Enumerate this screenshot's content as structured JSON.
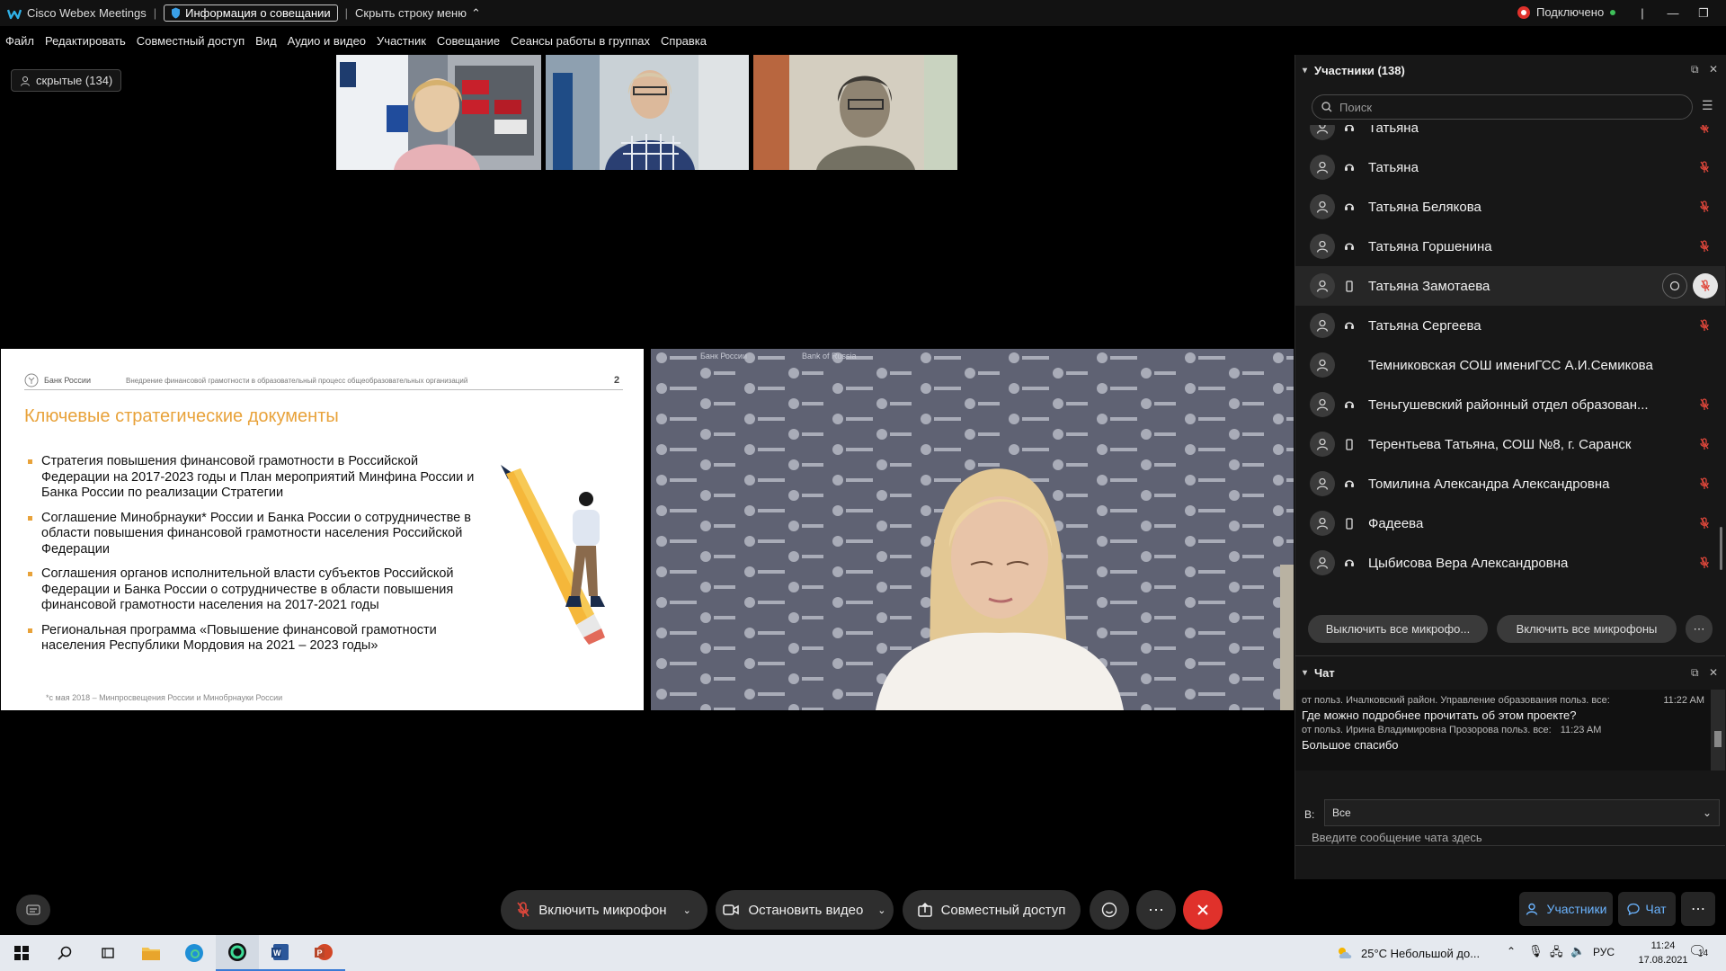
{
  "titlebar": {
    "app": "Cisco Webex Meetings",
    "meeting_info": "Информация о совещании",
    "hide_menu": "Скрыть строку меню",
    "connection": "Подключено"
  },
  "menu": [
    "Файл",
    "Редактировать",
    "Совместный доступ",
    "Вид",
    "Аудио и видео",
    "Участник",
    "Совещание",
    "Сеансы работы в группах",
    "Справка"
  ],
  "hidden_participants": "скрытые (134)",
  "slide": {
    "org": "Банк России",
    "header": "Внедрение финансовой грамотности в образовательный процесс общеобразовательных организаций",
    "page": "2",
    "title": "Ключевые стратегические документы",
    "bullets": [
      "Стратегия повышения финансовой грамотности в Российской Федерации на 2017-2023 годы и План мероприятий Минфина России и Банка России по реализации Стратегии",
      "Соглашение Минобрнауки* России и Банка России о сотрудничестве в области повышения финансовой грамотности населения Российской Федерации",
      "Соглашения органов исполнительной власти субъектов Российской Федерации и Банка России о сотрудничестве в области повышения финансовой грамотности населения на 2017-2021 годы",
      "Региональная программа «Повышение финансовой грамотности населения Республики Мордовия на 2021 – 2023 годы»"
    ],
    "footnote": "*с мая 2018 – Минпросвещения России и Минобрнауки России",
    "accent": "#e8a23a"
  },
  "backdrop": {
    "ru": "Банк России",
    "en": "Bank of Russia"
  },
  "participants": {
    "title": "Участники (138)",
    "search_placeholder": "Поиск",
    "list": [
      {
        "name": "Татьяна",
        "device": "voip"
      },
      {
        "name": "Татьяна",
        "device": "voip"
      },
      {
        "name": "Татьяна Белякова",
        "device": "voip"
      },
      {
        "name": "Татьяна Горшенина",
        "device": "voip"
      },
      {
        "name": "Татьяна Замотаева",
        "device": "phone"
      },
      {
        "name": "Татьяна Сергеева",
        "device": "voip"
      },
      {
        "name": "Темниковская СОШ имениГСС А.И.Семикова",
        "device": "none"
      },
      {
        "name": "Теньгушевский районный отдел образован...",
        "device": "voip"
      },
      {
        "name": "Терентьева Татьяна, СОШ №8, г. Саранск",
        "device": "phone"
      },
      {
        "name": "Томилина Александра Александровна",
        "device": "voip"
      },
      {
        "name": "Фадеева",
        "device": "phone"
      },
      {
        "name": "Цыбисова Вера Александровна",
        "device": "voip"
      }
    ],
    "mute_all": "Выключить все микрофо...",
    "unmute_all": "Включить все микрофоны"
  },
  "chat": {
    "title": "Чат",
    "messages": [
      {
        "meta": "от польз. Ичалковский район. Управление образования польз. все:",
        "time": "11:22 AM",
        "text": "Где можно подробнее прочитать об этом проекте?"
      },
      {
        "meta": "от польз. Ирина Владимировна Прозорова польз. все:",
        "time": "11:23 AM",
        "text": "Большое спасибо"
      }
    ],
    "to_label": "В:",
    "to_value": "Все",
    "input_placeholder": "Введите сообщение чата здесь"
  },
  "controls": {
    "mic": "Включить микрофон",
    "video": "Остановить видео",
    "share": "Совместный доступ",
    "participants": "Участники",
    "chat": "Чат"
  },
  "taskbar": {
    "weather": "25°C  Небольшой до...",
    "lang": "РУС",
    "time": "11:24",
    "date": "17.08.2021",
    "notifications": "14"
  },
  "colors": {
    "muted": "#e0473b",
    "leave": "#e0312b",
    "connected": "#3fbf5a"
  }
}
